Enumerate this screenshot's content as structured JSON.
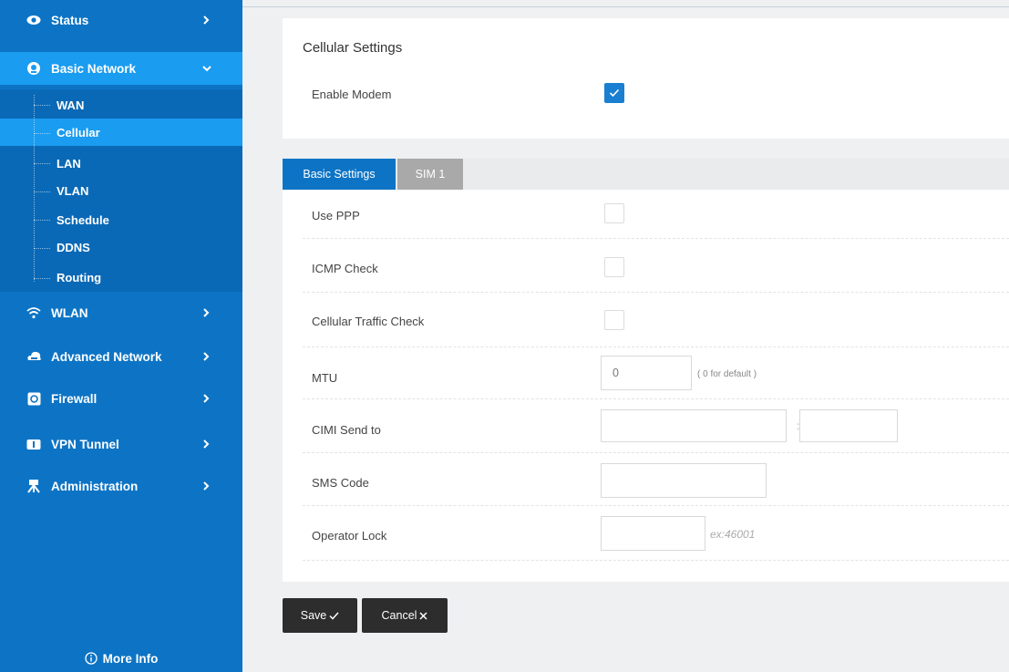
{
  "sidebar": {
    "items": [
      {
        "label": "Status",
        "icon": "eye-icon"
      },
      {
        "label": "Basic Network",
        "icon": "globe-icon"
      },
      {
        "label": "WLAN",
        "icon": "wifi-icon"
      },
      {
        "label": "Advanced Network",
        "icon": "cloud-icon"
      },
      {
        "label": "Firewall",
        "icon": "firewall-icon"
      },
      {
        "label": "VPN Tunnel",
        "icon": "vpn-icon"
      },
      {
        "label": "Administration",
        "icon": "admin-icon"
      }
    ],
    "sub_items": [
      "WAN",
      "Cellular",
      "LAN",
      "VLAN",
      "Schedule",
      "DDNS",
      "Routing"
    ],
    "more_info": "More Info",
    "colors": {
      "background": "#0d74c5",
      "active": "#1a9cf0"
    }
  },
  "cellular": {
    "title": "Cellular Settings",
    "enable_modem_label": "Enable Modem",
    "enable_modem_checked": true
  },
  "tabs": [
    {
      "label": "Basic Settings",
      "active": true
    },
    {
      "label": "SIM 1",
      "active": false
    }
  ],
  "form": {
    "use_ppp_label": "Use PPP",
    "icmp_check_label": "ICMP Check",
    "traffic_check_label": "Cellular Traffic Check",
    "mtu_label": "MTU",
    "mtu_value": "0",
    "mtu_hint": "( 0 for default )",
    "cimi_label": "CIMI Send to",
    "cimi_separator": ":",
    "sms_label": "SMS Code",
    "operator_lock_label": "Operator Lock",
    "operator_lock_placeholder": "ex:46001"
  },
  "buttons": {
    "save": "Save",
    "cancel": "Cancel"
  }
}
